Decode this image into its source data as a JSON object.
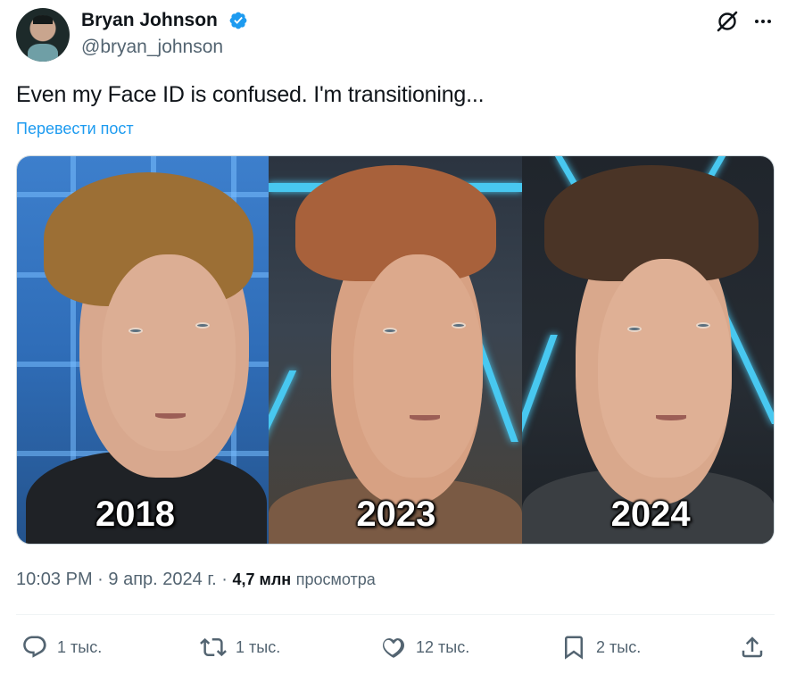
{
  "author": {
    "display_name": "Bryan Johnson",
    "handle": "@bryan_johnson",
    "verified": true,
    "avatar": "avatar"
  },
  "header_icons": [
    "grok-icon",
    "more-icon"
  ],
  "tweet": {
    "text": "Even my Face ID is confused. I'm transitioning...",
    "translate_label": "Перевести пост"
  },
  "media": {
    "panels": [
      {
        "year": "2018"
      },
      {
        "year": "2023"
      },
      {
        "year": "2024"
      }
    ]
  },
  "meta": {
    "time": "10:03 PM",
    "separator": "·",
    "date": "9 апр. 2024 г.",
    "views_count": "4,7 млн",
    "views_label": "просмотра"
  },
  "actions": {
    "reply": {
      "icon": "reply-icon",
      "count": "1 тыс."
    },
    "repost": {
      "icon": "repost-icon",
      "count": "1 тыс."
    },
    "like": {
      "icon": "heart-icon",
      "count": "12 тыс."
    },
    "bookmark": {
      "icon": "bookmark-icon",
      "count": "2 тыс."
    },
    "share": {
      "icon": "share-icon"
    }
  },
  "colors": {
    "accent": "#1d9bf0",
    "secondary_text": "#536471",
    "primary_text": "#0f1419"
  }
}
